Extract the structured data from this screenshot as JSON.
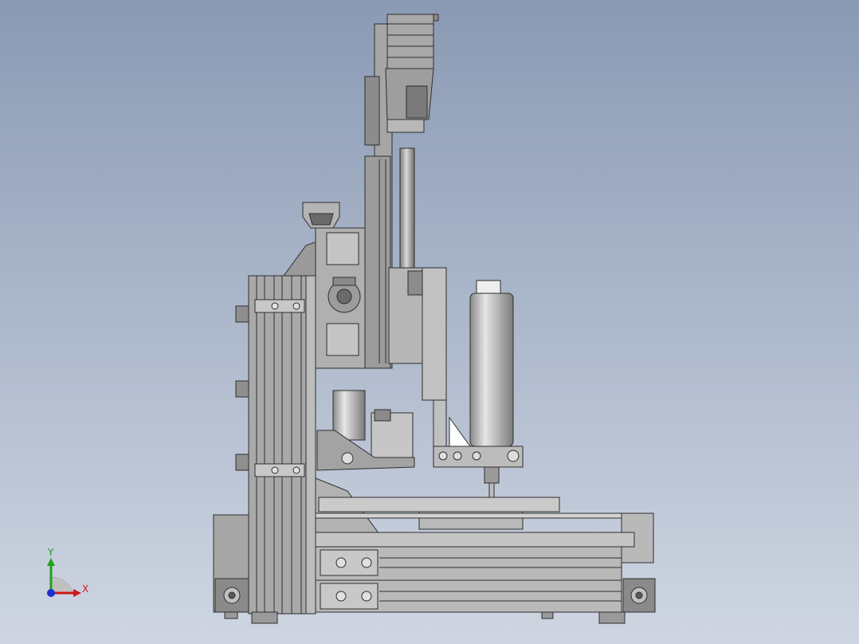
{
  "viewport": {
    "background_top": "#8a9ab4",
    "background_bottom": "#cfd6e2"
  },
  "palette": {
    "metal_light": "#c8c8c8",
    "metal_mid": "#a9a9a9",
    "metal_dark": "#6e6e6e",
    "edge": "#2e2e2e",
    "slot": "#4a4a4a"
  },
  "triad": {
    "y_label": "Y",
    "x_label": "X",
    "y_color": "#1fa01f",
    "x_color": "#d01818",
    "z_color": "#1e2fd0"
  }
}
